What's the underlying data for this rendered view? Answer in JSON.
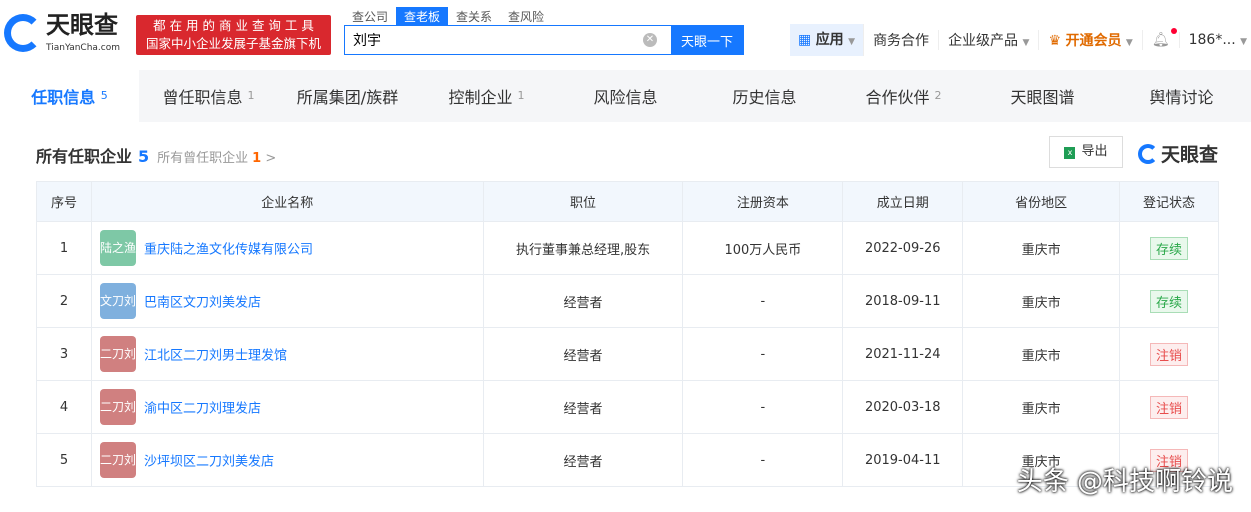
{
  "header": {
    "logo_text": "天眼查",
    "logo_sub": "TianYanCha.com",
    "slogan_line1": "都 在 用 的 商 业 查 询 工 具",
    "slogan_line2": "国家中小企业发展子基金旗下机构",
    "search_tabs": [
      "查公司",
      "查老板",
      "查关系",
      "查风险"
    ],
    "active_search_tab": "查老板",
    "search_value": "刘宇",
    "search_button": "天眼一下",
    "nav": {
      "app": "应用",
      "business": "商务合作",
      "enterprise": "企业级产品",
      "vip": "开通会员",
      "user": "186*..."
    }
  },
  "tabs": [
    {
      "label": "任职信息",
      "count": "5"
    },
    {
      "label": "曾任职信息",
      "count": "1"
    },
    {
      "label": "所属集团/族群",
      "count": ""
    },
    {
      "label": "控制企业",
      "count": "1"
    },
    {
      "label": "风险信息",
      "count": ""
    },
    {
      "label": "历史信息",
      "count": ""
    },
    {
      "label": "合作伙伴",
      "count": "2"
    },
    {
      "label": "天眼图谱",
      "count": ""
    },
    {
      "label": "舆情讨论",
      "count": ""
    }
  ],
  "section": {
    "title": "所有任职企业",
    "count": "5",
    "former_label": "所有曾任职企业",
    "former_count": "1",
    "export": "导出",
    "brand": "天眼查"
  },
  "table": {
    "columns": [
      "序号",
      "企业名称",
      "职位",
      "注册资本",
      "成立日期",
      "省份地区",
      "登记状态"
    ],
    "rows": [
      {
        "no": "1",
        "avatar": "陆之渔",
        "avatar_color": "#7ec8a6",
        "name": "重庆陆之渔文化传媒有限公司",
        "position": "执行董事兼总经理,股东",
        "capital": "100万人民币",
        "date": "2022-09-26",
        "region": "重庆市",
        "status": "存续",
        "status_type": "ok"
      },
      {
        "no": "2",
        "avatar": "文刀刘",
        "avatar_color": "#7fb0de",
        "name": "巴南区文刀刘美发店",
        "position": "经营者",
        "capital": "-",
        "date": "2018-09-11",
        "region": "重庆市",
        "status": "存续",
        "status_type": "ok"
      },
      {
        "no": "3",
        "avatar": "二刀刘",
        "avatar_color": "#d08080",
        "name": "江北区二刀刘男士理发馆",
        "position": "经营者",
        "capital": "-",
        "date": "2021-11-24",
        "region": "重庆市",
        "status": "注销",
        "status_type": "bad"
      },
      {
        "no": "4",
        "avatar": "二刀刘",
        "avatar_color": "#d08080",
        "name": "渝中区二刀刘理发店",
        "position": "经营者",
        "capital": "-",
        "date": "2020-03-18",
        "region": "重庆市",
        "status": "注销",
        "status_type": "bad"
      },
      {
        "no": "5",
        "avatar": "二刀刘",
        "avatar_color": "#d08080",
        "name": "沙坪坝区二刀刘美发店",
        "position": "经营者",
        "capital": "-",
        "date": "2019-04-11",
        "region": "重庆市",
        "status": "注销",
        "status_type": "bad"
      }
    ]
  },
  "watermark": "头条 @科技啊铃说",
  "colors": {
    "accent": "#1678ff",
    "ok": "#2ba84a",
    "bad": "#e84d4d"
  }
}
